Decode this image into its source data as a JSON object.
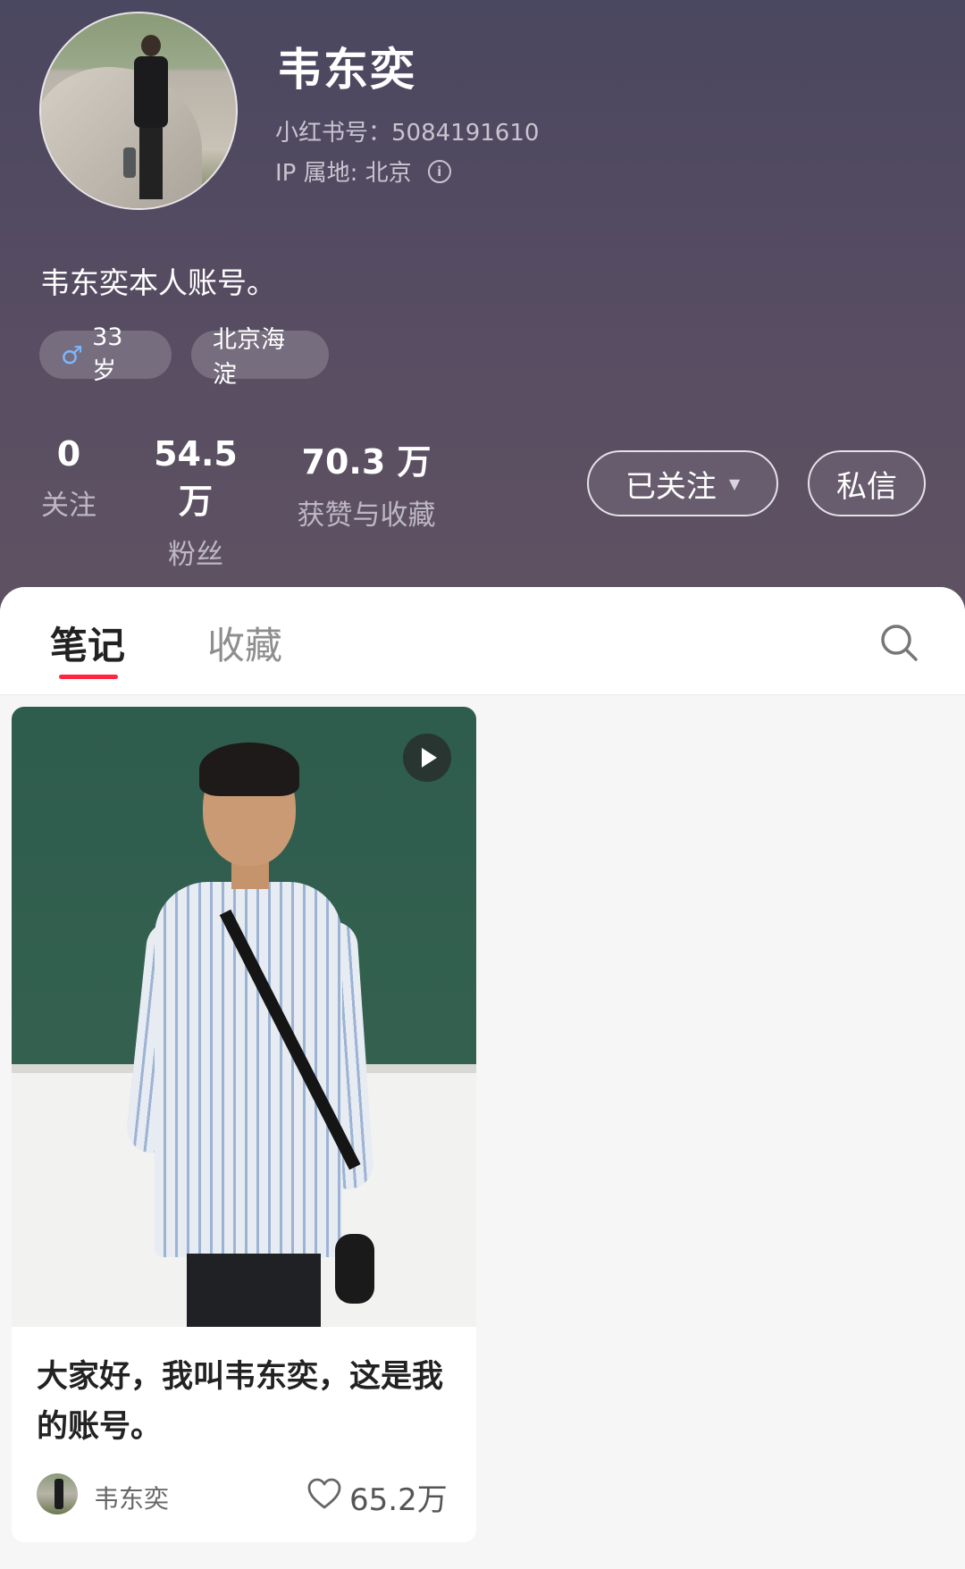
{
  "profile": {
    "name": "韦东奕",
    "red_id": "小红书号：5084191610",
    "ip_location": "IP 属地: 北京",
    "info_icon": "ⓘ",
    "bio": "韦东奕本人账号。",
    "tags": {
      "age": "33 岁",
      "gender_icon": "♂",
      "location": "北京海淀"
    },
    "stats": [
      {
        "value": "0",
        "label": "关注"
      },
      {
        "value": "54.5 万",
        "label": "粉丝"
      },
      {
        "value": "70.3 万",
        "label": "获赞与收藏"
      }
    ],
    "buttons": {
      "follow": "已关注",
      "follow_caret": "▼",
      "message": "私信"
    }
  },
  "tabs": {
    "items": [
      {
        "label": "笔记",
        "active": true
      },
      {
        "label": "收藏",
        "active": false
      }
    ],
    "accent_color": "#ff2442"
  },
  "notes": [
    {
      "title": "大家好，我叫韦东奕，这是我的账号。",
      "author": "韦东奕",
      "likes": "65.2万",
      "is_video": true
    }
  ]
}
